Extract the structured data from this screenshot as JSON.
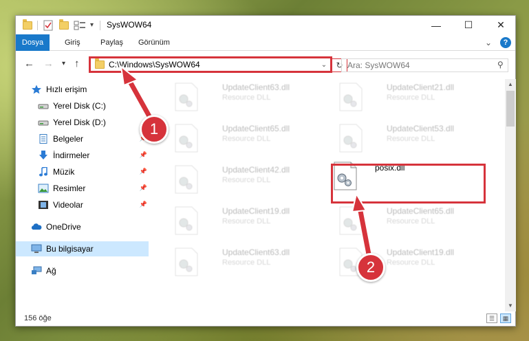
{
  "window": {
    "title": "SysWOW64",
    "controls": {
      "minimize": "—",
      "maximize": "☐",
      "close": "✕"
    }
  },
  "quick_access_toolbar": {
    "icons": [
      "folder-icon",
      "properties-icon",
      "new-folder-icon",
      "customize-icon"
    ],
    "dropdown": "▾"
  },
  "ribbon": {
    "tabs": [
      "Dosya",
      "Giriş",
      "Paylaş",
      "Görünüm"
    ],
    "expand": "⌄",
    "help": "?"
  },
  "navigation": {
    "back": "←",
    "forward": "→",
    "recent": "▾",
    "up": "↑",
    "address": "C:\\Windows\\SysWOW64",
    "address_dropdown": "⌄",
    "refresh": "↻",
    "search_placeholder": "Ara: SysWOW64",
    "search_icon": "⚲"
  },
  "sidebar": {
    "items": [
      {
        "label": "Hızlı erişim",
        "icon": "star-icon",
        "pinned": false
      },
      {
        "label": "Yerel Disk (C:)",
        "icon": "drive-icon",
        "pinned": false
      },
      {
        "label": "Yerel Disk (D:)",
        "icon": "drive-icon",
        "pinned": false
      },
      {
        "label": "Belgeler",
        "icon": "documents-icon",
        "pinned": true
      },
      {
        "label": "İndirmeler",
        "icon": "download-icon",
        "pinned": true
      },
      {
        "label": "Müzik",
        "icon": "music-icon",
        "pinned": true
      },
      {
        "label": "Resimler",
        "icon": "pictures-icon",
        "pinned": true
      },
      {
        "label": "Videolar",
        "icon": "video-icon",
        "pinned": true
      },
      {
        "label": "OneDrive",
        "icon": "onedrive-icon",
        "pinned": false
      },
      {
        "label": "Bu bilgisayar",
        "icon": "computer-icon",
        "pinned": false,
        "selected": true
      },
      {
        "label": "Ağ",
        "icon": "network-icon",
        "pinned": false
      }
    ]
  },
  "files": [
    {
      "name": "UpdateClient63.dll",
      "type": "Resource DLL",
      "faded": true
    },
    {
      "name": "UpdateClient21.dll",
      "type": "Resource DLL",
      "faded": true
    },
    {
      "name": "UpdateClient65.dll",
      "type": "Resource DLL",
      "faded": true
    },
    {
      "name": "UpdateClient53.dll",
      "type": "Resource DLL",
      "faded": true
    },
    {
      "name": "UpdateClient42.dll",
      "type": "Resource DLL",
      "faded": true
    },
    {
      "name": "posix.dll",
      "type": "",
      "faded": false
    },
    {
      "name": "UpdateClient19.dll",
      "type": "Resource DLL",
      "faded": true
    },
    {
      "name": "UpdateClient65.dll",
      "type": "Resource DLL",
      "faded": true
    },
    {
      "name": "UpdateClient63.dll",
      "type": "Resource DLL",
      "faded": true
    },
    {
      "name": "UpdateClient19.dll",
      "type": "Resource DLL",
      "faded": true
    }
  ],
  "status": {
    "item_count": "156 öğe"
  },
  "annotations": {
    "step1": "1",
    "step2": "2",
    "accent": "#d6333b"
  }
}
